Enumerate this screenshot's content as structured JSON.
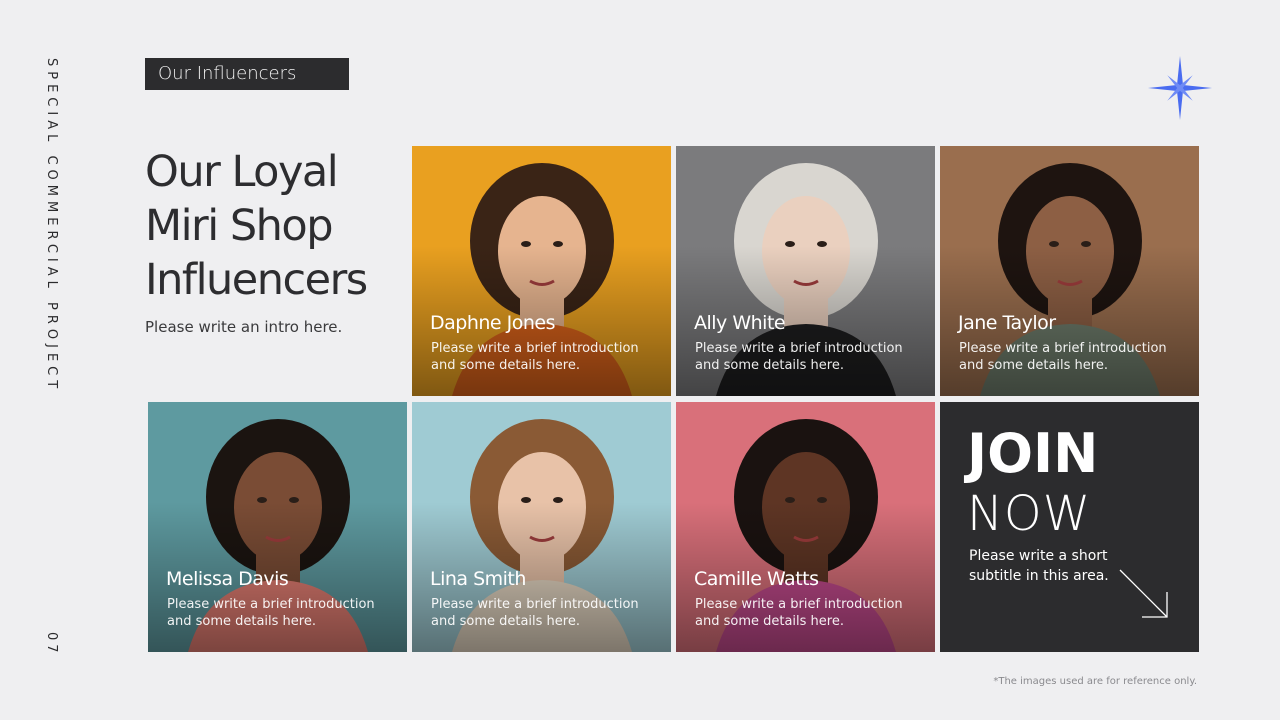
{
  "side_label": "SPECIAL COMMERCIAL PROJECT",
  "page_number": "07",
  "section_tag": "Our Influencers",
  "headline": [
    "Our Loyal",
    "Miri Shop",
    "Influencers"
  ],
  "intro": "Please write an intro here.",
  "influencers": [
    {
      "name": "Daphne Jones",
      "desc": "Please write a brief introduction and some details here.",
      "bg": "#e9a020",
      "hair": "#3a2416",
      "skin": "#e6b48f",
      "top": "#d9621a"
    },
    {
      "name": "Ally White",
      "desc": "Please write a brief introduction and some details here.",
      "bg": "#7b7b7d",
      "hair": "#d9d6d0",
      "skin": "#ead0bf",
      "top": "#1e1e1f"
    },
    {
      "name": "Jane Taylor",
      "desc": "Please write a brief introduction and some details here.",
      "bg": "#9a6e4e",
      "hair": "#1e1410",
      "skin": "#8d5f44",
      "top": "#6e7c6b"
    },
    {
      "name": "Melissa Davis",
      "desc": "Please write a brief introduction and some details here.",
      "bg": "#5e9aa0",
      "hair": "#1b1410",
      "skin": "#7a4c35",
      "top": "#e27d72"
    },
    {
      "name": "Lina Smith",
      "desc": "Please write a brief introduction and some details here.",
      "bg": "#9fcbd3",
      "hair": "#8a5a35",
      "skin": "#e8c2a8",
      "top": "#e4d6c2"
    },
    {
      "name": "Camille Watts",
      "desc": "Please write a brief introduction and some details here.",
      "bg": "#d9707a",
      "hair": "#1a1210",
      "skin": "#5e3524",
      "top": "#c24a8c"
    }
  ],
  "join": {
    "line1": "JOIN",
    "line2": "NOW",
    "subtitle": "Please write a short subtitle in this area."
  },
  "footnote": "*The images used are for reference only.",
  "colors": {
    "accent": "#4a6cf0",
    "dark": "#2c2c2e",
    "background": "#efeff1"
  }
}
